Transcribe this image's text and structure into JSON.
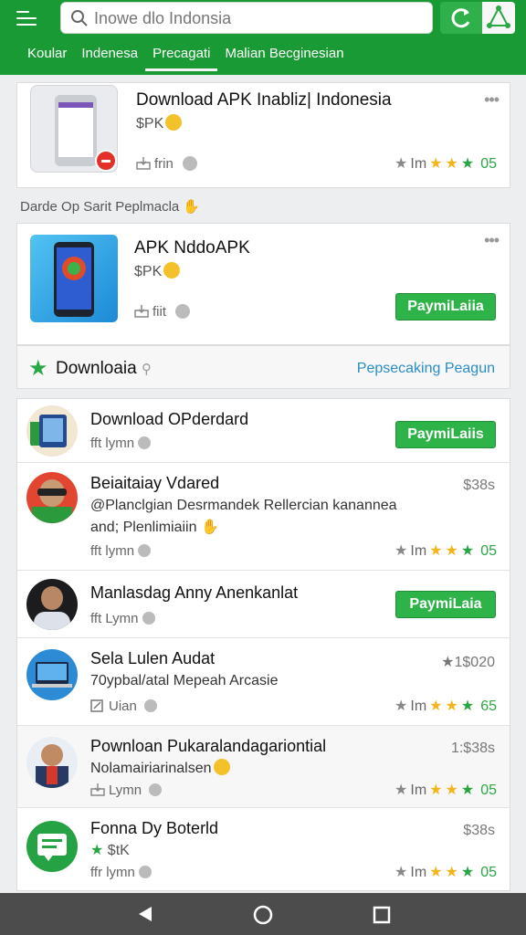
{
  "header": {
    "search_placeholder": "Inowe dlo Indonsia",
    "tabs": [
      "Koular",
      "Indenesa",
      "Precagati",
      "Malian  Becginesian"
    ],
    "active_tab": 2
  },
  "featured": [
    {
      "title": "Download APK Inabliz| Indonesia",
      "price": "$PK",
      "meta": "frin",
      "rating_label": "Im",
      "rating_value": "05",
      "menu": "•••"
    },
    {
      "title": "APK NddoAPK",
      "price": "$PK",
      "meta": "fiit",
      "button": "PaymiLaiia",
      "menu": "•••"
    }
  ],
  "section_label": "Darde Op Sarit Peplmacla",
  "downloads_header": {
    "label": "Downloaia",
    "link": "Pepsecaking Peagun"
  },
  "list": [
    {
      "title": "Download OPderdard",
      "meta": "fft lymn",
      "button": "PaymiLaiis"
    },
    {
      "title": "Beiaitaiay Vdared",
      "price": "$38s",
      "desc1": "@Planclgian Desrmandek Rellercian kanannea",
      "desc2": "and; Plenlimiaiin",
      "meta": "fft lymn",
      "rating_label": "Im",
      "rating_value": "05"
    },
    {
      "title": "Manlasdag Anny Anenkanlat",
      "meta": "fft Lymn",
      "button": "PaymiLaia"
    },
    {
      "title": "Sela Lulen Audat",
      "price": "★1$020",
      "desc1": "70ypbal/atal Mepeah Arcasie",
      "meta": "Uian",
      "rating_label": "Im",
      "rating_value": "65"
    },
    {
      "title": "Pownloan Pukaralandagariontial",
      "price": "1:$38s",
      "desc1": "Nolamairiarinalsen",
      "meta": "Lymn",
      "rating_label": "Im",
      "rating_value": "05"
    },
    {
      "title": "Fonna Dy Boterld",
      "price": "$38s",
      "desc1": "$tK",
      "meta": "ffr lymn",
      "rating_label": "Im",
      "rating_value": "05"
    }
  ],
  "colors": {
    "brand": "#1a9a35",
    "button": "#2eb348",
    "link": "#2a8ec6",
    "star": "#f2b51c"
  }
}
